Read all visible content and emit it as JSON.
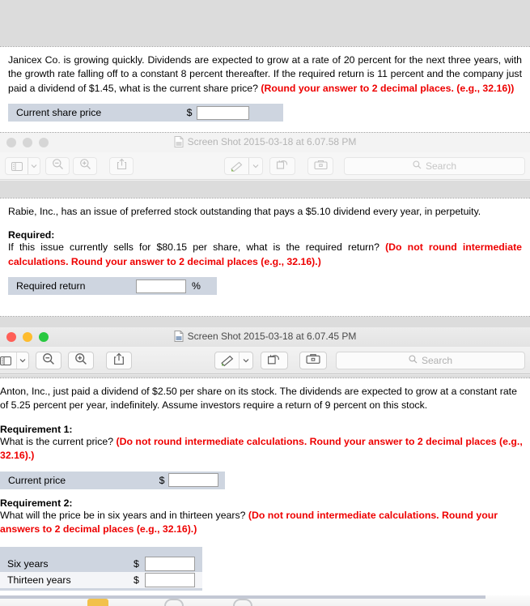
{
  "desktop": {
    "background_color": "#dcdcdc"
  },
  "documents": [
    {
      "id": "janicex",
      "paragraph": "Janicex Co. is growing quickly. Dividends are expected to grow at a rate of 20 percent for the next three years, with the growth rate falling off to a constant 8 percent thereafter. If the required return is 11 percent and the company just paid a dividend of $1.45, what is the current share price?",
      "instruction": "(Round your answer to 2 decimal places. (e.g., 32.16))",
      "answer_row": {
        "label": "Current share price",
        "symbol": "$",
        "value": "",
        "suffix": ""
      }
    },
    {
      "id": "rabie",
      "paragraph": "Rabie, Inc., has an issue of preferred stock outstanding that pays a $5.10 dividend every year, in perpetuity.",
      "required_heading": "Required:",
      "question": "If this issue currently sells for $80.15 per share, what is the required return?",
      "instruction": "(Do not round intermediate calculations. Round your answer to 2 decimal places (e.g., 32.16).)",
      "answer_row": {
        "label": "Required return",
        "symbol": "",
        "value": "",
        "suffix": "%"
      }
    },
    {
      "id": "anton",
      "paragraph": "Anton, Inc., just paid a dividend of $2.50 per share on its stock. The dividends are expected to grow at a constant rate of 5.25 percent per year, indefinitely. Assume investors require a return of 9 percent on this stock.",
      "requirement1_heading": "Requirement 1:",
      "requirement1_question": "What is the current price?",
      "requirement1_instruction": "(Do not round intermediate calculations. Round your answer to 2 decimal places (e.g., 32.16).)",
      "answer_row": {
        "label": "Current price",
        "symbol": "$",
        "value": "",
        "suffix": ""
      },
      "requirement2_heading": "Requirement 2:",
      "requirement2_question": "What will the price be in six years and in thirteen years?",
      "requirement2_instruction": "(Do not round intermediate calculations. Round your answers to 2 decimal places (e.g., 32.16).)",
      "table": {
        "rows": [
          {
            "label": "Six years",
            "symbol": "$",
            "value": ""
          },
          {
            "label": "Thirteen years",
            "symbol": "$",
            "value": ""
          }
        ]
      }
    }
  ],
  "windows": [
    {
      "id": "window-upper",
      "state": "inactive",
      "title": "Screen Shot 2015-03-18 at 6.07.58 PM",
      "traffic_lights": [
        "close",
        "minimize",
        "zoom"
      ],
      "toolbar": {
        "sidebar_button": "sidebar-toggle",
        "sidebar_chevron": "chevron-down",
        "zoom_out_button": "zoom-out",
        "zoom_in_button": "zoom-in",
        "share_button": "share",
        "markup_button": "markup-pen",
        "markup_chevron": "chevron-down",
        "rotate_button": "rotate-left",
        "toolbox_button": "markup-toolbox",
        "search_placeholder": "Search"
      }
    },
    {
      "id": "window-lower",
      "state": "active",
      "title": "Screen Shot 2015-03-18 at 6.07.45 PM",
      "traffic_lights": [
        "close",
        "minimize",
        "zoom"
      ],
      "toolbar": {
        "sidebar_button": "sidebar-toggle",
        "sidebar_chevron": "chevron-down",
        "zoom_out_button": "zoom-out",
        "zoom_in_button": "zoom-in",
        "share_button": "share",
        "markup_button": "markup-pen",
        "markup_chevron": "chevron-down",
        "rotate_button": "rotate-left",
        "toolbox_button": "markup-toolbox",
        "search_placeholder": "Search"
      }
    }
  ],
  "dock": {
    "items": [
      "folder-icon",
      "circle-app-icon",
      "circle-app-icon"
    ]
  },
  "colors": {
    "instruction_red": "#ee0000",
    "answer_row_bg": "#ced5e0",
    "traffic_close": "#ff5f57",
    "traffic_min": "#febc2e",
    "traffic_max": "#28c840"
  }
}
